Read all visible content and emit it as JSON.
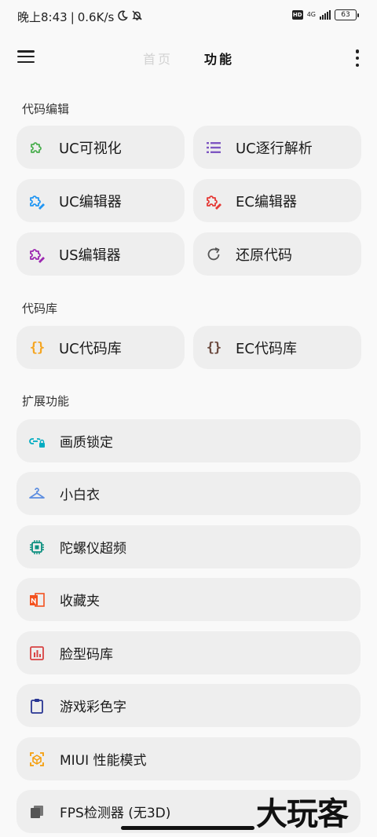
{
  "status_bar": {
    "time": "晚上8:43",
    "net_speed": "0.6K/s",
    "hd": "HD",
    "network": "4G",
    "battery": "63"
  },
  "app_bar": {
    "tabs": [
      {
        "label": "首页",
        "active": false
      },
      {
        "label": "功能",
        "active": true
      }
    ]
  },
  "sections": {
    "code_edit": "代码编辑",
    "code_lib": "代码库",
    "extended": "扩展功能"
  },
  "code_edit_items": [
    {
      "label": "UC可视化",
      "icon": "puzzle-icon",
      "color": "#4caf50"
    },
    {
      "label": "UC逐行解析",
      "icon": "list-icon",
      "color": "#7e57c2"
    },
    {
      "label": "UC编辑器",
      "icon": "puzzle-edit-icon",
      "color": "#2196f3"
    },
    {
      "label": "EC编辑器",
      "icon": "puzzle-edit-icon",
      "color": "#e53935"
    },
    {
      "label": "US编辑器",
      "icon": "puzzle-edit-icon",
      "color": "#9c27b0"
    },
    {
      "label": "还原代码",
      "icon": "refresh-icon",
      "color": "#555555"
    }
  ],
  "code_lib_items": [
    {
      "label": "UC代码库",
      "icon": "braces-icon",
      "color": "#f5a623"
    },
    {
      "label": "EC代码库",
      "icon": "braces-icon",
      "color": "#6d4c41"
    }
  ],
  "extended_items": [
    {
      "label": "画质锁定",
      "icon": "link-lock-icon",
      "color": "#00acc1"
    },
    {
      "label": "小白衣",
      "icon": "hanger-icon",
      "color": "#5c8de0"
    },
    {
      "label": "陀螺仪超频",
      "icon": "chip-icon",
      "color": "#0b8f7f"
    },
    {
      "label": "收藏夹",
      "icon": "collection-icon",
      "color": "#f4511e"
    },
    {
      "label": "脸型码库",
      "icon": "chart-icon",
      "color": "#d84343"
    },
    {
      "label": "游戏彩色字",
      "icon": "clipboard-icon",
      "color": "#283593"
    },
    {
      "label": "MIUI 性能模式",
      "icon": "box-icon",
      "color": "#f59e0b"
    },
    {
      "label": "FPS检测器 (无3D)",
      "icon": "stack-icon",
      "color": "#555555"
    }
  ],
  "watermark": "大玩客"
}
